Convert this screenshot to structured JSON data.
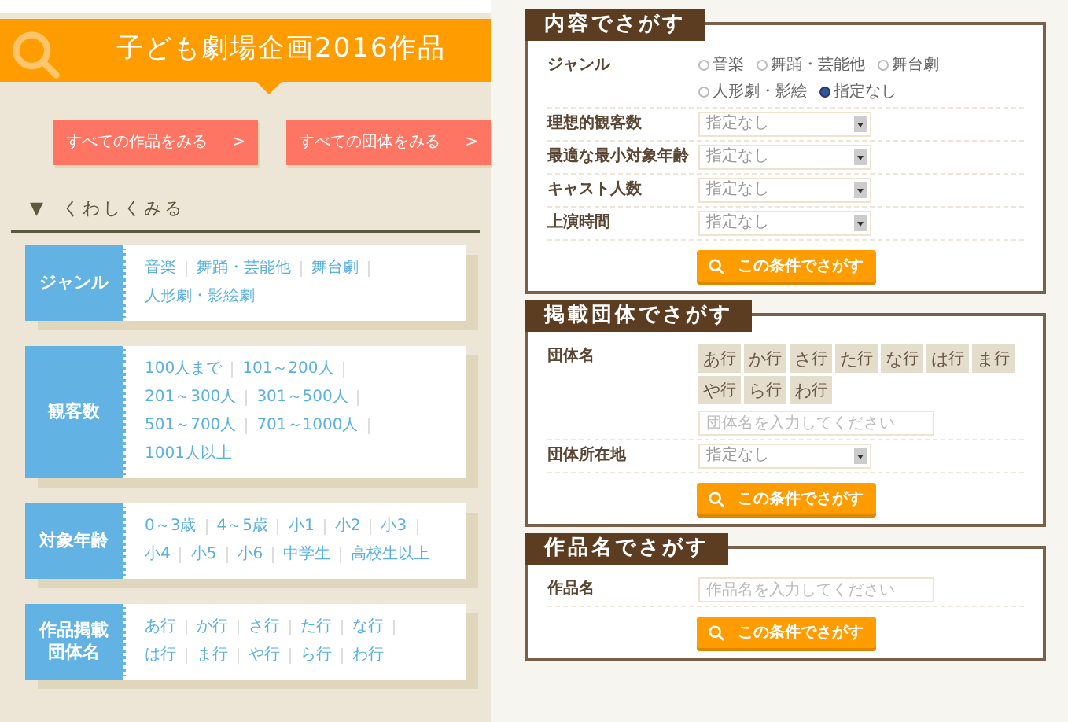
{
  "header": {
    "title": "子ども劇場企画2016作品"
  },
  "buttons": [
    {
      "label": "すべての作品をみる",
      "arrow": ">"
    },
    {
      "label": "すべての団体をみる",
      "arrow": ">"
    }
  ],
  "details_toggle": {
    "icon": "▼",
    "label": "くわしくみる"
  },
  "filters": [
    {
      "label": "ジャンル",
      "links": [
        "音楽",
        "舞踊・芸能他",
        "舞台劇",
        "人形劇・影絵劇"
      ]
    },
    {
      "label": "観客数",
      "links": [
        "100人まで",
        "101～200人",
        "201～300人",
        "301～500人",
        "501～700人",
        "701～1000人",
        "1001人以上"
      ]
    },
    {
      "label": "対象年齢",
      "links": [
        "0～3歳",
        "4～5歳",
        "小1",
        "小2",
        "小3",
        "小4",
        "小5",
        "小6",
        "中学生",
        "高校生以上"
      ]
    },
    {
      "label": "作品掲載団体名",
      "links": [
        "あ行",
        "か行",
        "さ行",
        "た行",
        "な行",
        "は行",
        "ま行",
        "や行",
        "ら行",
        "わ行"
      ]
    }
  ],
  "search_panels": [
    {
      "title": "内容でさがす",
      "button": "この条件でさがす",
      "fields": [
        {
          "kind": "radio",
          "label": "ジャンル",
          "options": [
            {
              "label": "音楽",
              "selected": false
            },
            {
              "label": "舞踊・芸能他",
              "selected": false
            },
            {
              "label": "舞台劇",
              "selected": false
            },
            {
              "label": "人形劇・影絵",
              "selected": false
            },
            {
              "label": "指定なし",
              "selected": true
            }
          ]
        },
        {
          "kind": "select",
          "label": "理想的観客数",
          "value": "指定なし"
        },
        {
          "kind": "select",
          "label": "最適な最小対象年齢",
          "value": "指定なし"
        },
        {
          "kind": "select",
          "label": "キャスト人数",
          "value": "指定なし"
        },
        {
          "kind": "select",
          "label": "上演時間",
          "value": "指定なし"
        }
      ]
    },
    {
      "title": "掲載団体でさがす",
      "button": "この条件でさがす",
      "fields": [
        {
          "kind": "kana",
          "label": "団体名",
          "keys": [
            {
              "main": "あ",
              "sub": "行"
            },
            {
              "main": "か",
              "sub": "行"
            },
            {
              "main": "さ",
              "sub": "行"
            },
            {
              "main": "た",
              "sub": "行"
            },
            {
              "main": "な",
              "sub": "行"
            },
            {
              "main": "は",
              "sub": "行"
            },
            {
              "main": "ま",
              "sub": "行"
            },
            {
              "main": "や",
              "sub": "行"
            },
            {
              "main": "ら",
              "sub": "行"
            },
            {
              "main": "わ",
              "sub": "行"
            }
          ],
          "placeholder": "団体名を入力してください"
        },
        {
          "kind": "select",
          "label": "団体所在地",
          "value": "指定なし"
        }
      ]
    },
    {
      "title": "作品名でさがす",
      "button": "この条件でさがす",
      "fields": [
        {
          "kind": "text",
          "label": "作品名",
          "placeholder": "作品名を入力してください"
        }
      ]
    }
  ]
}
